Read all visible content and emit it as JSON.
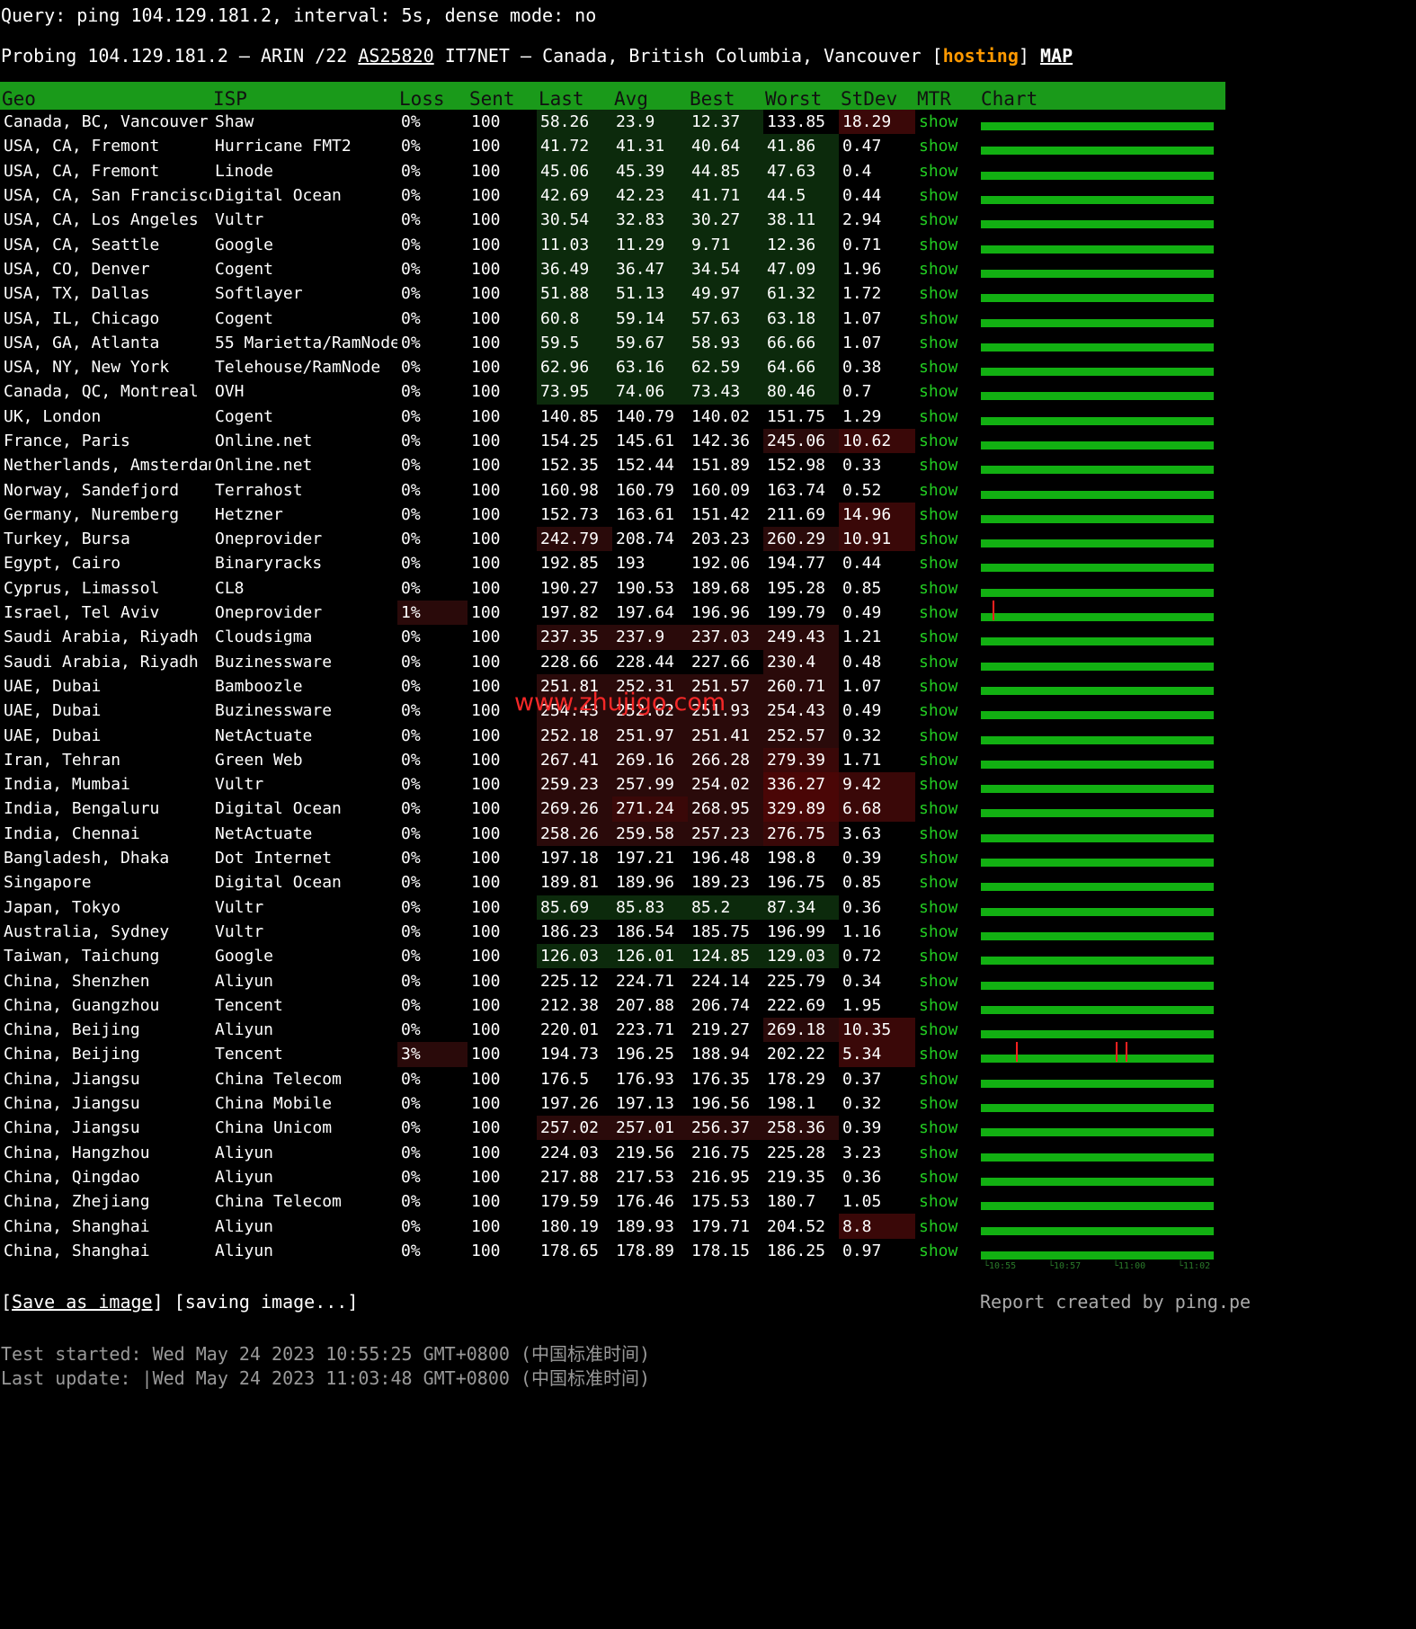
{
  "query_line": "Query: ping 104.129.181.2, interval: 5s, dense mode: no",
  "probe": {
    "prefix": "Probing 104.129.181.2 – ARIN /22 ",
    "asn": "AS25820",
    "mid": " IT7NET – Canada, British Columbia, Vancouver [",
    "hosting": "hosting",
    "bracket_close": "] ",
    "map": "MAP"
  },
  "colors": {
    "header_bg": "#1a9a1a",
    "bar": "#12b012",
    "show_link": "#22cc22",
    "hosting": "#ff9900",
    "spike": "#ff2020"
  },
  "table": {
    "headers": [
      "Geo",
      "ISP",
      "Loss",
      "Sent",
      "Last",
      "Avg",
      "Best",
      "Worst",
      "StDev",
      "MTR",
      "Chart"
    ],
    "show_label": "show",
    "rows": [
      [
        "Canada, BC, Vancouver",
        "Shaw",
        "0%",
        "100",
        "58.26",
        "23.9",
        "12.37",
        "133.85",
        "18.29"
      ],
      [
        "USA, CA, Fremont",
        "Hurricane FMT2",
        "0%",
        "100",
        "41.72",
        "41.31",
        "40.64",
        "41.86",
        "0.47"
      ],
      [
        "USA, CA, Fremont",
        "Linode",
        "0%",
        "100",
        "45.06",
        "45.39",
        "44.85",
        "47.63",
        "0.4"
      ],
      [
        "USA, CA, San Francisco",
        "Digital Ocean",
        "0%",
        "100",
        "42.69",
        "42.23",
        "41.71",
        "44.5",
        "0.44"
      ],
      [
        "USA, CA, Los Angeles",
        "Vultr",
        "0%",
        "100",
        "30.54",
        "32.83",
        "30.27",
        "38.11",
        "2.94"
      ],
      [
        "USA, CA, Seattle",
        "Google",
        "0%",
        "100",
        "11.03",
        "11.29",
        "9.71",
        "12.36",
        "0.71"
      ],
      [
        "USA, CO, Denver",
        "Cogent",
        "0%",
        "100",
        "36.49",
        "36.47",
        "34.54",
        "47.09",
        "1.96"
      ],
      [
        "USA, TX, Dallas",
        "Softlayer",
        "0%",
        "100",
        "51.88",
        "51.13",
        "49.97",
        "61.32",
        "1.72"
      ],
      [
        "USA, IL, Chicago",
        "Cogent",
        "0%",
        "100",
        "60.8",
        "59.14",
        "57.63",
        "63.18",
        "1.07"
      ],
      [
        "USA, GA, Atlanta",
        "55 Marietta/RamNode",
        "0%",
        "100",
        "59.5",
        "59.67",
        "58.93",
        "66.66",
        "1.07"
      ],
      [
        "USA, NY, New York",
        "Telehouse/RamNode",
        "0%",
        "100",
        "62.96",
        "63.16",
        "62.59",
        "64.66",
        "0.38"
      ],
      [
        "Canada, QC, Montreal",
        "OVH",
        "0%",
        "100",
        "73.95",
        "74.06",
        "73.43",
        "80.46",
        "0.7"
      ],
      [
        "UK, London",
        "Cogent",
        "0%",
        "100",
        "140.85",
        "140.79",
        "140.02",
        "151.75",
        "1.29"
      ],
      [
        "France, Paris",
        "Online.net",
        "0%",
        "100",
        "154.25",
        "145.61",
        "142.36",
        "245.06",
        "10.62"
      ],
      [
        "Netherlands, Amsterdam",
        "Online.net",
        "0%",
        "100",
        "152.35",
        "152.44",
        "151.89",
        "152.98",
        "0.33"
      ],
      [
        "Norway, Sandefjord",
        "Terrahost",
        "0%",
        "100",
        "160.98",
        "160.79",
        "160.09",
        "163.74",
        "0.52"
      ],
      [
        "Germany, Nuremberg",
        "Hetzner",
        "0%",
        "100",
        "152.73",
        "163.61",
        "151.42",
        "211.69",
        "14.96"
      ],
      [
        "Turkey, Bursa",
        "Oneprovider",
        "0%",
        "100",
        "242.79",
        "208.74",
        "203.23",
        "260.29",
        "10.91"
      ],
      [
        "Egypt, Cairo",
        "Binaryracks",
        "0%",
        "100",
        "192.85",
        "193",
        "192.06",
        "194.77",
        "0.44"
      ],
      [
        "Cyprus, Limassol",
        "CL8",
        "0%",
        "100",
        "190.27",
        "190.53",
        "189.68",
        "195.28",
        "0.85"
      ],
      [
        "Israel, Tel Aviv",
        "Oneprovider",
        "1%",
        "100",
        "197.82",
        "197.64",
        "196.96",
        "199.79",
        "0.49"
      ],
      [
        "Saudi Arabia, Riyadh",
        "Cloudsigma",
        "0%",
        "100",
        "237.35",
        "237.9",
        "237.03",
        "249.43",
        "1.21"
      ],
      [
        "Saudi Arabia, Riyadh",
        "Buzinessware",
        "0%",
        "100",
        "228.66",
        "228.44",
        "227.66",
        "230.4",
        "0.48"
      ],
      [
        "UAE, Dubai",
        "Bamboozle",
        "0%",
        "100",
        "251.81",
        "252.31",
        "251.57",
        "260.71",
        "1.07"
      ],
      [
        "UAE, Dubai",
        "Buzinessware",
        "0%",
        "100",
        "254.43",
        "252.62",
        "251.93",
        "254.43",
        "0.49"
      ],
      [
        "UAE, Dubai",
        "NetActuate",
        "0%",
        "100",
        "252.18",
        "251.97",
        "251.41",
        "252.57",
        "0.32"
      ],
      [
        "Iran, Tehran",
        "Green Web",
        "0%",
        "100",
        "267.41",
        "269.16",
        "266.28",
        "279.39",
        "1.71"
      ],
      [
        "India, Mumbai",
        "Vultr",
        "0%",
        "100",
        "259.23",
        "257.99",
        "254.02",
        "336.27",
        "9.42"
      ],
      [
        "India, Bengaluru",
        "Digital Ocean",
        "0%",
        "100",
        "269.26",
        "271.24",
        "268.95",
        "329.89",
        "6.68"
      ],
      [
        "India, Chennai",
        "NetActuate",
        "0%",
        "100",
        "258.26",
        "259.58",
        "257.23",
        "276.75",
        "3.63"
      ],
      [
        "Bangladesh, Dhaka",
        "Dot Internet",
        "0%",
        "100",
        "197.18",
        "197.21",
        "196.48",
        "198.8",
        "0.39"
      ],
      [
        "Singapore",
        "Digital Ocean",
        "0%",
        "100",
        "189.81",
        "189.96",
        "189.23",
        "196.75",
        "0.85"
      ],
      [
        "Japan, Tokyo",
        "Vultr",
        "0%",
        "100",
        "85.69",
        "85.83",
        "85.2",
        "87.34",
        "0.36"
      ],
      [
        "Australia, Sydney",
        "Vultr",
        "0%",
        "100",
        "186.23",
        "186.54",
        "185.75",
        "196.99",
        "1.16"
      ],
      [
        "Taiwan, Taichung",
        "Google",
        "0%",
        "100",
        "126.03",
        "126.01",
        "124.85",
        "129.03",
        "0.72"
      ],
      [
        "China, Shenzhen",
        "Aliyun",
        "0%",
        "100",
        "225.12",
        "224.71",
        "224.14",
        "225.79",
        "0.34"
      ],
      [
        "China, Guangzhou",
        "Tencent",
        "0%",
        "100",
        "212.38",
        "207.88",
        "206.74",
        "222.69",
        "1.95"
      ],
      [
        "China, Beijing",
        "Aliyun",
        "0%",
        "100",
        "220.01",
        "223.71",
        "219.27",
        "269.18",
        "10.35"
      ],
      [
        "China, Beijing",
        "Tencent",
        "3%",
        "100",
        "194.73",
        "196.25",
        "188.94",
        "202.22",
        "5.34"
      ],
      [
        "China, Jiangsu",
        "China Telecom",
        "0%",
        "100",
        "176.5",
        "176.93",
        "176.35",
        "178.29",
        "0.37"
      ],
      [
        "China, Jiangsu",
        "China Mobile",
        "0%",
        "100",
        "197.26",
        "197.13",
        "196.56",
        "198.1",
        "0.32"
      ],
      [
        "China, Jiangsu",
        "China Unicom",
        "0%",
        "100",
        "257.02",
        "257.01",
        "256.37",
        "258.36",
        "0.39"
      ],
      [
        "China, Hangzhou",
        "Aliyun",
        "0%",
        "100",
        "224.03",
        "219.56",
        "216.75",
        "225.28",
        "3.23"
      ],
      [
        "China, Qingdao",
        "Aliyun",
        "0%",
        "100",
        "217.88",
        "217.53",
        "216.95",
        "219.35",
        "0.36"
      ],
      [
        "China, Zhejiang",
        "China Telecom",
        "0%",
        "100",
        "179.59",
        "176.46",
        "175.53",
        "180.7",
        "1.05"
      ],
      [
        "China, Shanghai",
        "Aliyun",
        "0%",
        "100",
        "180.19",
        "189.93",
        "179.71",
        "204.52",
        "8.8"
      ],
      [
        "China, Shanghai",
        "Aliyun",
        "0%",
        "100",
        "178.65",
        "178.89",
        "178.15",
        "186.25",
        "0.97"
      ]
    ],
    "loss_spikes": {
      "20": [
        0.05
      ],
      "38": [
        0.15,
        0.58,
        0.62
      ]
    }
  },
  "chart_axis": [
    "└10:55",
    "└10:57",
    "└11:00",
    "└11:02"
  ],
  "footer": {
    "save_open": "[",
    "save_link": "Save as image",
    "save_close": "] [saving image...]",
    "credit": "Report created by ping.pe",
    "started": "Test started: Wed May 24 2023 10:55:25 GMT+0800 (中国标准时间)",
    "updated": "Last update: |Wed May 24 2023 11:03:48 GMT+0800 (中国标准时间)"
  },
  "watermark": "www.zhujigo.com"
}
